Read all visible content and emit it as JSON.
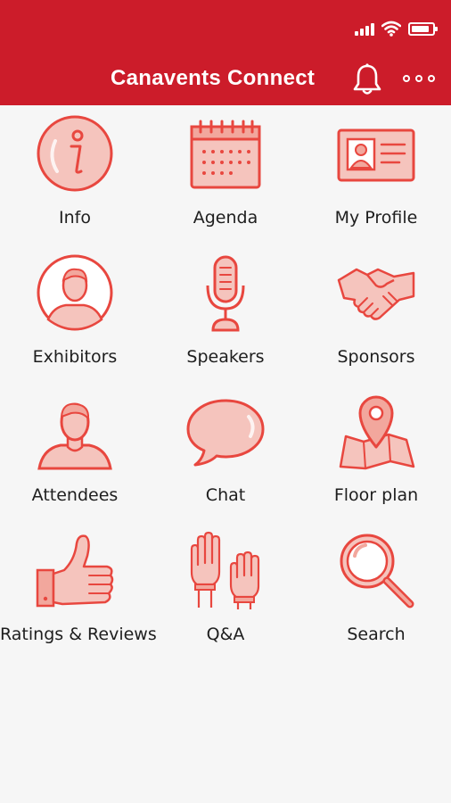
{
  "colors": {
    "brand_red": "#cc1c2a",
    "icon_red": "#e8473f",
    "icon_fill": "#f5c4bd",
    "background": "#f6f6f6"
  },
  "status_bar": {
    "icons": [
      "signal-icon",
      "wifi-icon",
      "battery-icon"
    ]
  },
  "app_bar": {
    "title": "Canavents Connect",
    "icons": [
      "bell-icon",
      "more-options-icon"
    ]
  },
  "menu": {
    "items": [
      {
        "label": "Info",
        "icon": "info-icon"
      },
      {
        "label": "Agenda",
        "icon": "calendar-icon"
      },
      {
        "label": "My Profile",
        "icon": "id-card-icon"
      },
      {
        "label": "Exhibitors",
        "icon": "exhibitor-person-icon"
      },
      {
        "label": "Speakers",
        "icon": "microphone-icon"
      },
      {
        "label": "Sponsors",
        "icon": "handshake-icon"
      },
      {
        "label": "Attendees",
        "icon": "person-icon"
      },
      {
        "label": "Chat",
        "icon": "speech-bubble-icon"
      },
      {
        "label": "Floor plan",
        "icon": "map-pin-icon"
      },
      {
        "label": "Ratings & Reviews",
        "icon": "thumbs-up-icon"
      },
      {
        "label": "Q&A",
        "icon": "raised-hands-icon"
      },
      {
        "label": "Search",
        "icon": "magnifier-icon"
      }
    ]
  }
}
